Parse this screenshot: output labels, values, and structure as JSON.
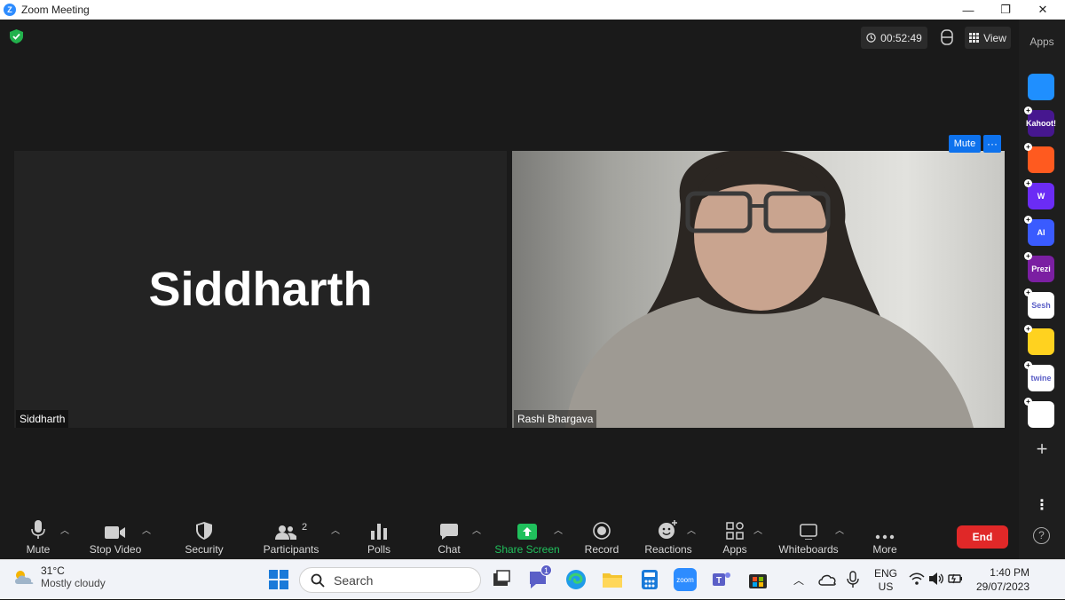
{
  "window": {
    "title": "Zoom Meeting",
    "minimize": "—",
    "restore": "❐",
    "close": "✕"
  },
  "meeting": {
    "timer": "00:52:49",
    "view_label": "View",
    "participants": [
      {
        "name": "Siddharth",
        "display_name": "Siddharth"
      },
      {
        "name": "Rashi Bhargava"
      }
    ],
    "mute_label": "Mute",
    "more_label": "···"
  },
  "apps_panel": {
    "label": "Apps",
    "apps": [
      {
        "name": "",
        "color": "#1f8fff"
      },
      {
        "name": "Kahoot!",
        "color": "#46178f"
      },
      {
        "name": "",
        "color": "#ff5a1f"
      },
      {
        "name": "W",
        "color": "#6b2cf5"
      },
      {
        "name": "AI",
        "color": "#3a5bff"
      },
      {
        "name": "Prezi",
        "color": "#7b1fa2"
      },
      {
        "name": "Sesh",
        "color": "#ffffff"
      },
      {
        "name": "",
        "color": "#ffd21f"
      },
      {
        "name": "twine",
        "color": "#ffffff"
      },
      {
        "name": "",
        "color": "#ffffff"
      }
    ]
  },
  "toolbar": {
    "mute": "Mute",
    "stop_video": "Stop Video",
    "security": "Security",
    "participants": "Participants",
    "participants_count": "2",
    "polls": "Polls",
    "chat": "Chat",
    "share_screen": "Share Screen",
    "record": "Record",
    "reactions": "Reactions",
    "apps": "Apps",
    "whiteboards": "Whiteboards",
    "more": "More",
    "end": "End",
    "share_color": "#20c05c",
    "end_color": "#e02828"
  },
  "taskbar": {
    "weather_temp": "31°C",
    "weather_desc": "Mostly cloudy",
    "search_placeholder": "Search",
    "chat_badge": "1",
    "zoom_app": "zoom",
    "lang_top": "ENG",
    "lang_bottom": "US",
    "time": "1:40 PM",
    "date": "29/07/2023"
  }
}
